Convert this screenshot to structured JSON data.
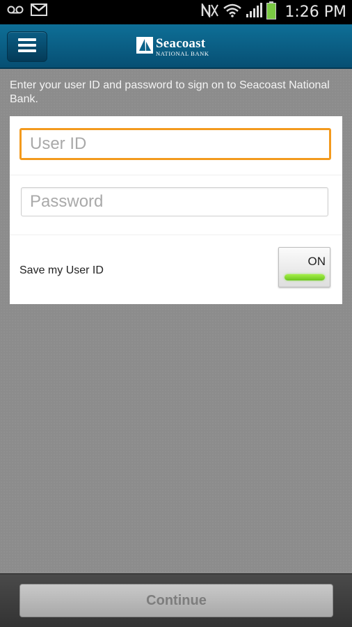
{
  "status_bar": {
    "time": "1:26 PM",
    "icons": [
      "voicemail-icon",
      "gmail-icon",
      "nfc-icon",
      "wifi-icon",
      "signal-icon",
      "battery-icon"
    ],
    "battery_color": "#7ac943"
  },
  "header": {
    "menu_icon": "hamburger-menu-icon",
    "brand_name": "Seacoast",
    "brand_sub": "NATIONAL BANK",
    "background": "#0a6289"
  },
  "login": {
    "intro": "Enter your user ID and password to sign on to Seacoast National Bank.",
    "user_id_placeholder": "User ID",
    "user_id_value": "",
    "password_placeholder": "Password",
    "password_value": "",
    "save_label": "Save my User ID",
    "save_toggle": "ON",
    "focus_color": "#f39a1d"
  },
  "footer": {
    "continue_label": "Continue"
  }
}
